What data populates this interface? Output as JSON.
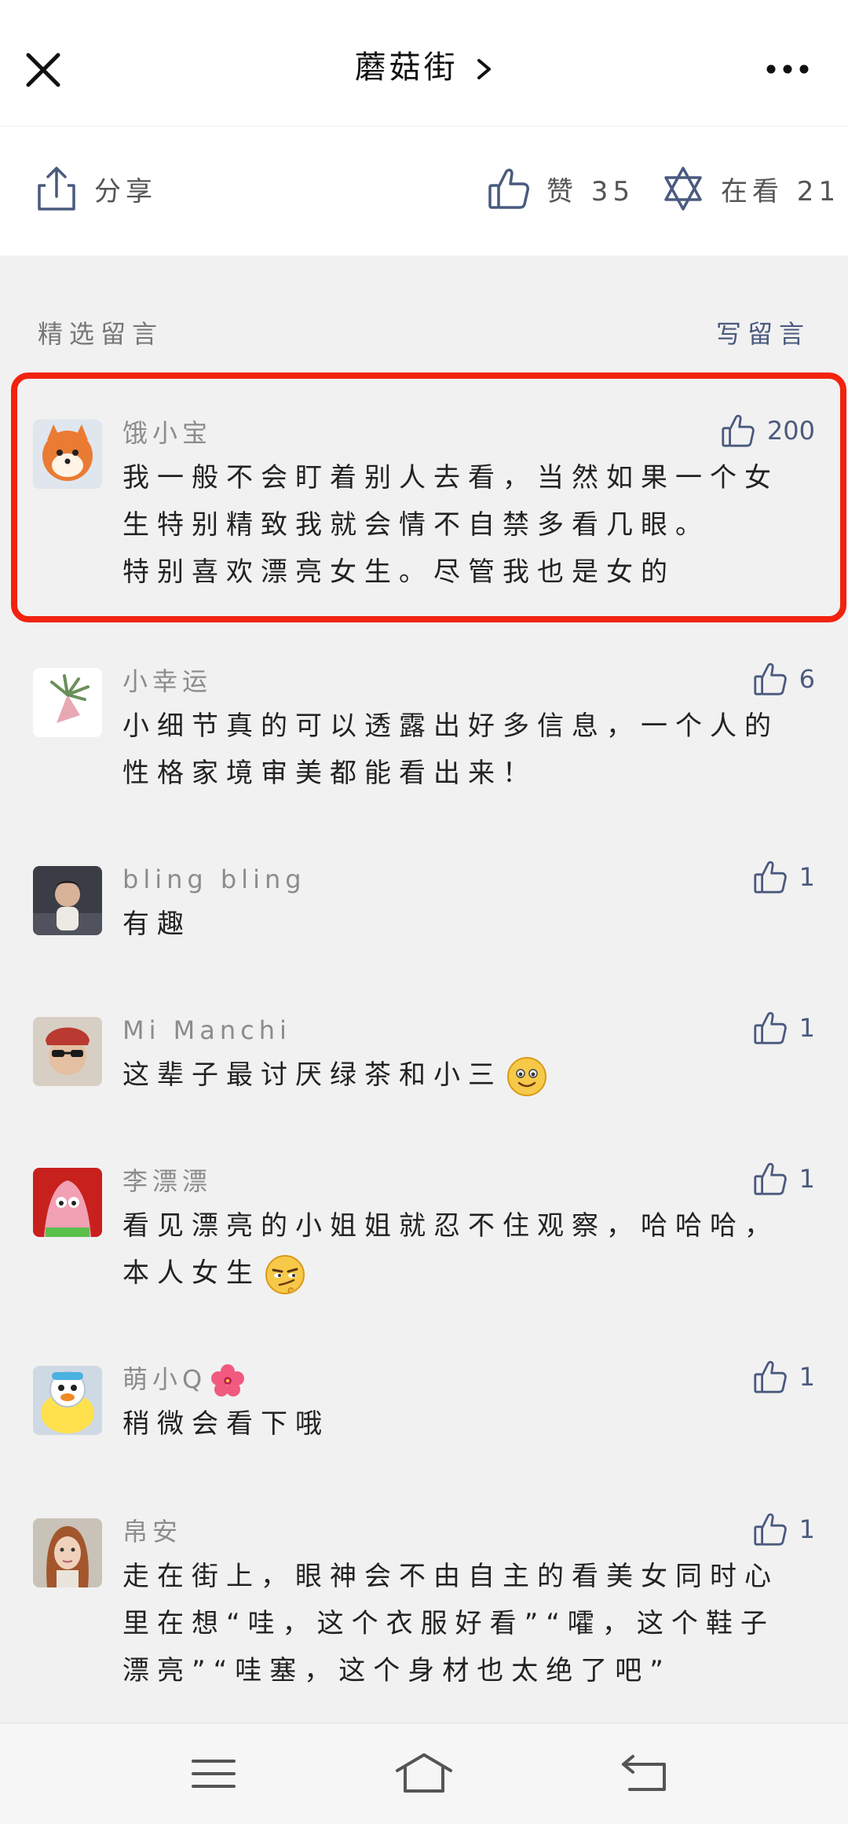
{
  "header": {
    "title": "蘑菇街",
    "close_icon": "close-icon",
    "more_icon": "more-icon"
  },
  "actions": {
    "share_label": "分享",
    "like_label": "赞 35",
    "watch_label": "在看 21"
  },
  "comments_section": {
    "title": "精选留言",
    "write_label": "写留言",
    "highlight_color": "#f1230f"
  },
  "comments": [
    {
      "name": "饿小宝",
      "likes": "200",
      "lines": [
        "我一般不会盯着别人去看，当然如果一个女",
        "生特别精致我就会情不自禁多看几眼。",
        "特别喜欢漂亮女生。尽管我也是女的"
      ],
      "highlighted": true
    },
    {
      "name": "小幸运",
      "likes": "6",
      "lines": [
        "小细节真的可以透露出好多信息，一个人的",
        "性格家境审美都能看出来！"
      ]
    },
    {
      "name": "bling bling",
      "likes": "1",
      "lines": [
        "有趣"
      ]
    },
    {
      "name": "Mi Manchi",
      "likes": "1",
      "lines": [
        "这辈子最讨厌绿茶和小三"
      ]
    },
    {
      "name": "李漂漂",
      "likes": "1",
      "lines": [
        "看见漂亮的小姐姐就忍不住观察，哈哈哈，",
        "本人女生"
      ]
    },
    {
      "name": "萌小Q",
      "likes": "1",
      "lines": [
        "稍微会看下哦"
      ]
    },
    {
      "name": "帛安",
      "likes": "1",
      "lines": [
        "走在街上，眼神会不由自主的看美女同时心",
        "里在想“哇，这个衣服好看”“嚯，这个鞋子",
        "漂亮”“哇塞，这个身材也太绝了吧”"
      ]
    }
  ],
  "colors": {
    "accent": "#4a5a7e",
    "name_gray": "#8c8c8c",
    "background": "#f1f1f1"
  }
}
